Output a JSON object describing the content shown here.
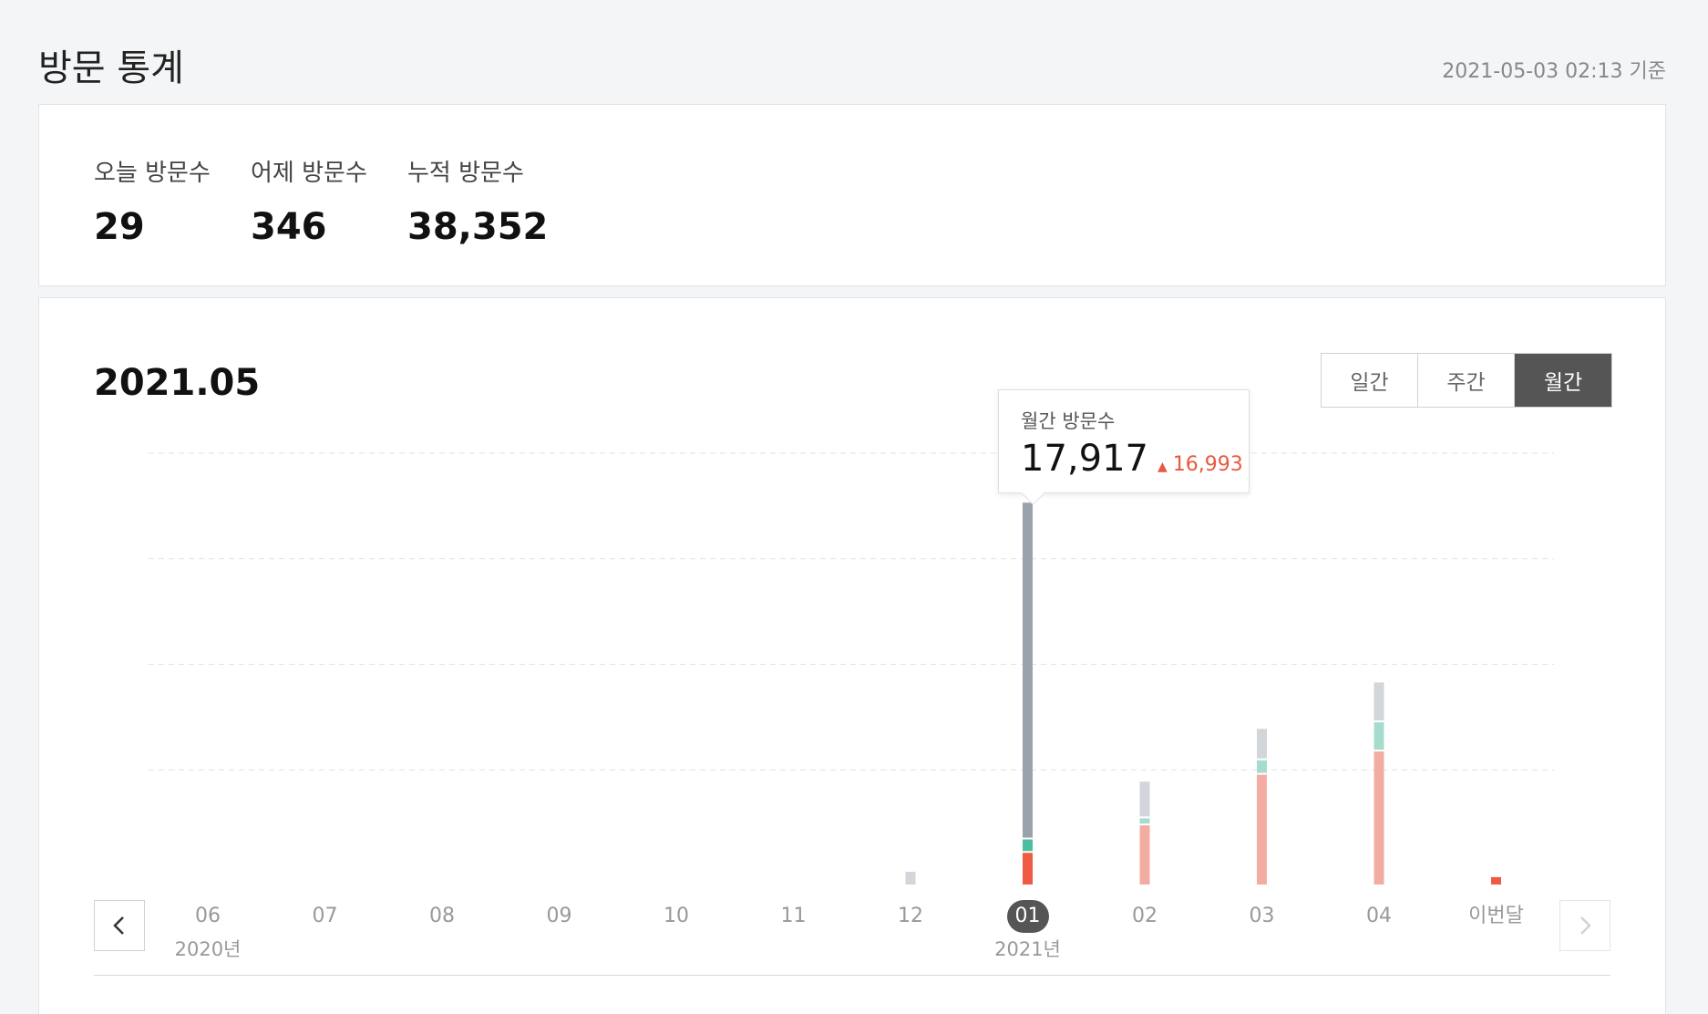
{
  "header": {
    "title": "방문 통계",
    "updated": "2021-05-03 02:13 기준"
  },
  "summary": {
    "today_label": "오늘 방문수",
    "today_value": "29",
    "yesterday_label": "어제 방문수",
    "yesterday_value": "346",
    "total_label": "누적 방문수",
    "total_value": "38,352"
  },
  "chart": {
    "period": "2021.05",
    "tabs": [
      "일간",
      "주간",
      "월간"
    ],
    "active_tab": "월간",
    "tooltip": {
      "label": "월간 방문수",
      "value": "17,917",
      "delta": "16,993"
    },
    "months": [
      "06",
      "07",
      "08",
      "09",
      "10",
      "11",
      "12",
      "01",
      "02",
      "03",
      "04",
      "이번달"
    ],
    "active_month": "01",
    "years": [
      {
        "label": "2020년",
        "month": "06"
      },
      {
        "label": "2021년",
        "month": "01"
      }
    ]
  },
  "chart_data": {
    "type": "bar",
    "stacked": true,
    "categories": [
      "06",
      "07",
      "08",
      "09",
      "10",
      "11",
      "12",
      "01",
      "02",
      "03",
      "04",
      "이번달"
    ],
    "series": [
      {
        "values": [
          0,
          0,
          0,
          0,
          0,
          0,
          0,
          1500,
          2800,
          5200,
          6300,
          350
        ]
      },
      {
        "values": [
          0,
          0,
          0,
          0,
          0,
          0,
          0,
          550,
          250,
          600,
          1300,
          0
        ]
      },
      {
        "values": [
          0,
          0,
          0,
          0,
          0,
          0,
          600,
          15867,
          1650,
          1400,
          1800,
          0
        ]
      }
    ],
    "ylim": [
      0,
      20000
    ],
    "grid": true,
    "colors": {
      "bottom": "#ee5a44",
      "bottom_light": "#f2aca2",
      "middle": "#4dbd9f",
      "middle_light": "#a6dccd",
      "top": "#9aa3ab",
      "top_light": "#d2d5d9"
    },
    "highlight": "01"
  }
}
